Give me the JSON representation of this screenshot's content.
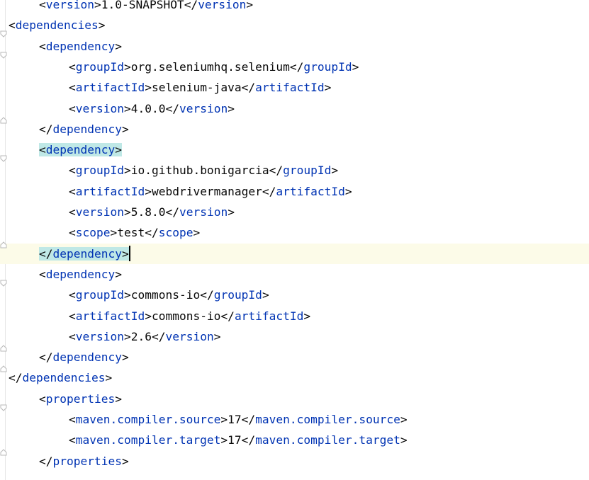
{
  "editor": {
    "lines": [
      {
        "indent": 1,
        "segments": [
          {
            "k": "p",
            "v": "<"
          },
          {
            "k": "t",
            "v": "version"
          },
          {
            "k": "p",
            "v": ">"
          },
          {
            "k": "x",
            "v": "1.0-SNAPSHOT"
          },
          {
            "k": "p",
            "v": "</"
          },
          {
            "k": "t",
            "v": "version"
          },
          {
            "k": "p",
            "v": ">"
          }
        ]
      },
      {
        "indent": 0,
        "fold": "open",
        "segments": [
          {
            "k": "p",
            "v": "<"
          },
          {
            "k": "t",
            "v": "dependencies"
          },
          {
            "k": "p",
            "v": ">"
          }
        ]
      },
      {
        "indent": 1,
        "fold": "open",
        "segments": [
          {
            "k": "p",
            "v": "<"
          },
          {
            "k": "t",
            "v": "dependency"
          },
          {
            "k": "p",
            "v": ">"
          }
        ]
      },
      {
        "indent": 2,
        "segments": [
          {
            "k": "p",
            "v": "<"
          },
          {
            "k": "t",
            "v": "groupId"
          },
          {
            "k": "p",
            "v": ">"
          },
          {
            "k": "x",
            "v": "org.seleniumhq.selenium"
          },
          {
            "k": "p",
            "v": "</"
          },
          {
            "k": "t",
            "v": "groupId"
          },
          {
            "k": "p",
            "v": ">"
          }
        ]
      },
      {
        "indent": 2,
        "segments": [
          {
            "k": "p",
            "v": "<"
          },
          {
            "k": "t",
            "v": "artifactId"
          },
          {
            "k": "p",
            "v": ">"
          },
          {
            "k": "x",
            "v": "selenium-java"
          },
          {
            "k": "p",
            "v": "</"
          },
          {
            "k": "t",
            "v": "artifactId"
          },
          {
            "k": "p",
            "v": ">"
          }
        ]
      },
      {
        "indent": 2,
        "segments": [
          {
            "k": "p",
            "v": "<"
          },
          {
            "k": "t",
            "v": "version"
          },
          {
            "k": "p",
            "v": ">"
          },
          {
            "k": "x",
            "v": "4.0.0"
          },
          {
            "k": "p",
            "v": "</"
          },
          {
            "k": "t",
            "v": "version"
          },
          {
            "k": "p",
            "v": ">"
          }
        ]
      },
      {
        "indent": 1,
        "fold": "close",
        "segments": [
          {
            "k": "p",
            "v": "</"
          },
          {
            "k": "t",
            "v": "dependency"
          },
          {
            "k": "p",
            "v": ">"
          }
        ]
      },
      {
        "indent": 1,
        "fold": "open",
        "segments": [
          {
            "k": "p",
            "v": "<",
            "hl": true
          },
          {
            "k": "t",
            "v": "dependency",
            "hl": true
          },
          {
            "k": "p",
            "v": ">",
            "hl": true
          }
        ]
      },
      {
        "indent": 2,
        "segments": [
          {
            "k": "p",
            "v": "<"
          },
          {
            "k": "t",
            "v": "groupId"
          },
          {
            "k": "p",
            "v": ">"
          },
          {
            "k": "x",
            "v": "io.github.bonigarcia"
          },
          {
            "k": "p",
            "v": "</"
          },
          {
            "k": "t",
            "v": "groupId"
          },
          {
            "k": "p",
            "v": ">"
          }
        ]
      },
      {
        "indent": 2,
        "segments": [
          {
            "k": "p",
            "v": "<"
          },
          {
            "k": "t",
            "v": "artifactId"
          },
          {
            "k": "p",
            "v": ">"
          },
          {
            "k": "x",
            "v": "webdrivermanager"
          },
          {
            "k": "p",
            "v": "</"
          },
          {
            "k": "t",
            "v": "artifactId"
          },
          {
            "k": "p",
            "v": ">"
          }
        ]
      },
      {
        "indent": 2,
        "segments": [
          {
            "k": "p",
            "v": "<"
          },
          {
            "k": "t",
            "v": "version"
          },
          {
            "k": "p",
            "v": ">"
          },
          {
            "k": "x",
            "v": "5.8.0"
          },
          {
            "k": "p",
            "v": "</"
          },
          {
            "k": "t",
            "v": "version"
          },
          {
            "k": "p",
            "v": ">"
          }
        ]
      },
      {
        "indent": 2,
        "segments": [
          {
            "k": "p",
            "v": "<"
          },
          {
            "k": "t",
            "v": "scope"
          },
          {
            "k": "p",
            "v": ">"
          },
          {
            "k": "x",
            "v": "test"
          },
          {
            "k": "p",
            "v": "</"
          },
          {
            "k": "t",
            "v": "scope"
          },
          {
            "k": "p",
            "v": ">"
          }
        ]
      },
      {
        "indent": 1,
        "fold": "close",
        "current": true,
        "caret": true,
        "segments": [
          {
            "k": "p",
            "v": "</",
            "hl": true
          },
          {
            "k": "t",
            "v": "dependency",
            "hl": true
          },
          {
            "k": "p",
            "v": ">",
            "hl": true
          }
        ]
      },
      {
        "indent": 1,
        "fold": "open",
        "segments": [
          {
            "k": "p",
            "v": "<"
          },
          {
            "k": "t",
            "v": "dependency"
          },
          {
            "k": "p",
            "v": ">"
          }
        ]
      },
      {
        "indent": 2,
        "segments": [
          {
            "k": "p",
            "v": "<"
          },
          {
            "k": "t",
            "v": "groupId"
          },
          {
            "k": "p",
            "v": ">"
          },
          {
            "k": "x",
            "v": "commons-io"
          },
          {
            "k": "p",
            "v": "</"
          },
          {
            "k": "t",
            "v": "groupId"
          },
          {
            "k": "p",
            "v": ">"
          }
        ]
      },
      {
        "indent": 2,
        "segments": [
          {
            "k": "p",
            "v": "<"
          },
          {
            "k": "t",
            "v": "artifactId"
          },
          {
            "k": "p",
            "v": ">"
          },
          {
            "k": "x",
            "v": "commons-io"
          },
          {
            "k": "p",
            "v": "</"
          },
          {
            "k": "t",
            "v": "artifactId"
          },
          {
            "k": "p",
            "v": ">"
          }
        ]
      },
      {
        "indent": 2,
        "segments": [
          {
            "k": "p",
            "v": "<"
          },
          {
            "k": "t",
            "v": "version"
          },
          {
            "k": "p",
            "v": ">"
          },
          {
            "k": "x",
            "v": "2.6"
          },
          {
            "k": "p",
            "v": "</"
          },
          {
            "k": "t",
            "v": "version"
          },
          {
            "k": "p",
            "v": ">"
          }
        ]
      },
      {
        "indent": 1,
        "fold": "close",
        "segments": [
          {
            "k": "p",
            "v": "</"
          },
          {
            "k": "t",
            "v": "dependency"
          },
          {
            "k": "p",
            "v": ">"
          }
        ]
      },
      {
        "indent": 0,
        "fold": "close",
        "segments": [
          {
            "k": "p",
            "v": "</"
          },
          {
            "k": "t",
            "v": "dependencies"
          },
          {
            "k": "p",
            "v": ">"
          }
        ]
      },
      {
        "indent": 1,
        "fold": "open",
        "segments": [
          {
            "k": "p",
            "v": "<"
          },
          {
            "k": "t",
            "v": "properties"
          },
          {
            "k": "p",
            "v": ">"
          }
        ]
      },
      {
        "indent": 2,
        "segments": [
          {
            "k": "p",
            "v": "<"
          },
          {
            "k": "t",
            "v": "maven.compiler.source"
          },
          {
            "k": "p",
            "v": ">"
          },
          {
            "k": "x",
            "v": "17"
          },
          {
            "k": "p",
            "v": "</"
          },
          {
            "k": "t",
            "v": "maven.compiler.source"
          },
          {
            "k": "p",
            "v": ">"
          }
        ]
      },
      {
        "indent": 2,
        "segments": [
          {
            "k": "p",
            "v": "<"
          },
          {
            "k": "t",
            "v": "maven.compiler.target"
          },
          {
            "k": "p",
            "v": ">"
          },
          {
            "k": "x",
            "v": "17"
          },
          {
            "k": "p",
            "v": "</"
          },
          {
            "k": "t",
            "v": "maven.compiler.target"
          },
          {
            "k": "p",
            "v": ">"
          }
        ]
      },
      {
        "indent": 1,
        "fold": "close",
        "segments": [
          {
            "k": "p",
            "v": "</"
          },
          {
            "k": "t",
            "v": "properties"
          },
          {
            "k": "p",
            "v": ">"
          }
        ]
      }
    ]
  },
  "colors": {
    "tag": "#0033b3",
    "text": "#080808",
    "current_line": "#fcfbe8",
    "brace_match": "#bfe8e6"
  }
}
